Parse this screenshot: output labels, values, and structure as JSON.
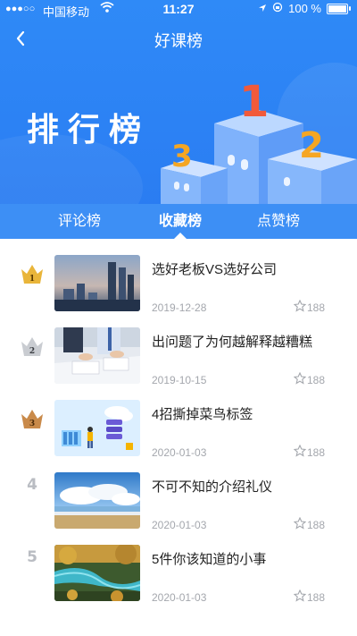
{
  "status_bar": {
    "signal": "●●●○○",
    "carrier": "中国移动",
    "time": "11:27",
    "battery": "100 %"
  },
  "nav": {
    "title": "好课榜"
  },
  "banner": {
    "title": "排行榜",
    "podium_numbers": [
      "1",
      "2",
      "3"
    ]
  },
  "tabs": [
    "评论榜",
    "收藏榜",
    "点赞榜"
  ],
  "active_tab": "收藏榜",
  "items": [
    {
      "rank": "1",
      "title": "选好老板VS选好公司",
      "date": "2019-12-28",
      "likes": "188"
    },
    {
      "rank": "2",
      "title": "出问题了为何越解释越糟糕",
      "date": "2019-10-15",
      "likes": "188"
    },
    {
      "rank": "3",
      "title": "4招撕掉菜鸟标签",
      "date": "2020-01-03",
      "likes": "188"
    },
    {
      "rank": "4",
      "title": "不可不知的介绍礼仪",
      "date": "2020-01-03",
      "likes": "188"
    },
    {
      "rank": "5",
      "title": "5件你该知道的小事",
      "date": "2020-01-03",
      "likes": "188"
    }
  ],
  "colors": {
    "primary": "#2f8af7",
    "gold": "#e9b53a",
    "silver": "#c9ccd1",
    "bronze": "#c98a4a",
    "muted": "#a4a7ad"
  },
  "icons": {
    "back": "chevron-left-icon",
    "like": "star-outline-icon",
    "rank_badge": "crown-icon"
  }
}
